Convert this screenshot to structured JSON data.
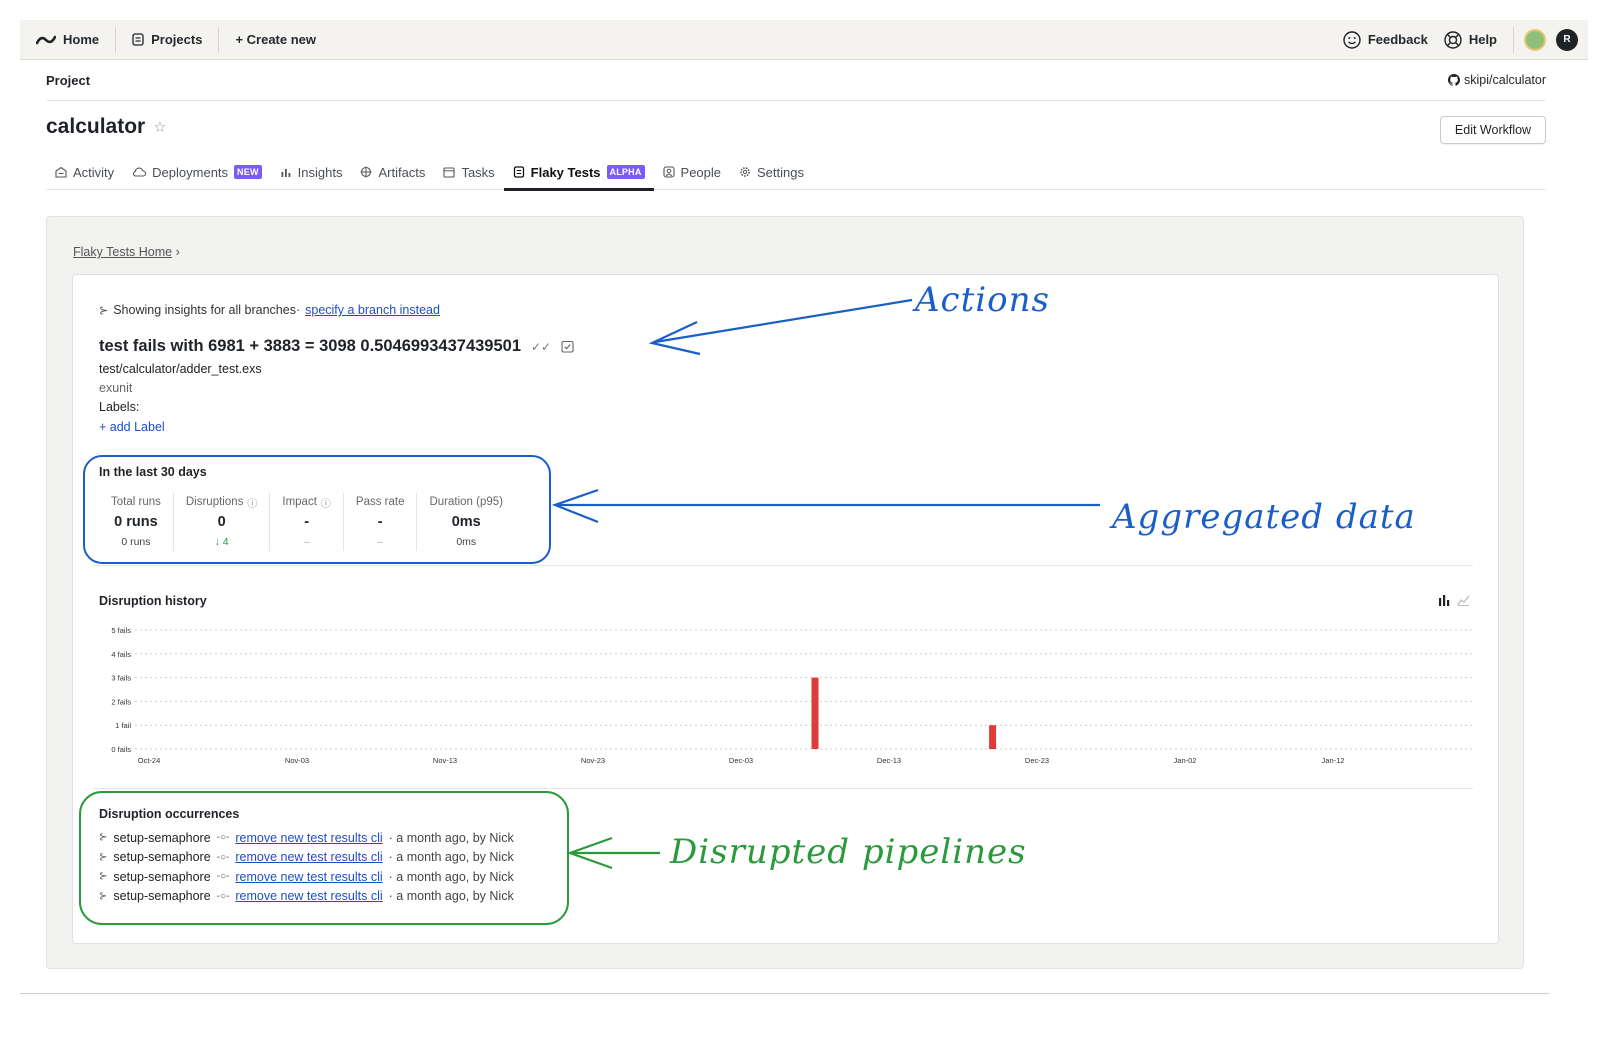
{
  "topbar": {
    "home": "Home",
    "projects": "Projects",
    "create_new": "+ Create new",
    "feedback": "Feedback",
    "help": "Help",
    "avatar_initial": "R"
  },
  "project": {
    "section_label": "Project",
    "repo": "skipi/calculator",
    "name": "calculator",
    "edit_workflow": "Edit Workflow"
  },
  "tabs": [
    {
      "label": "Activity",
      "icon": "activity-icon"
    },
    {
      "label": "Deployments",
      "icon": "cloud-icon",
      "badge": "NEW"
    },
    {
      "label": "Insights",
      "icon": "bar-chart-icon"
    },
    {
      "label": "Artifacts",
      "icon": "artifacts-icon"
    },
    {
      "label": "Tasks",
      "icon": "calendar-icon"
    },
    {
      "label": "Flaky Tests",
      "icon": "flaky-icon",
      "badge": "ALPHA",
      "active": true
    },
    {
      "label": "People",
      "icon": "people-icon"
    },
    {
      "label": "Settings",
      "icon": "gear-icon"
    }
  ],
  "breadcrumb": {
    "link": "Flaky Tests Home",
    "sep": "›"
  },
  "branch_info": {
    "prefix": "Showing insights for all branches·",
    "link": "specify a branch instead"
  },
  "test": {
    "title": "test fails with 6981 + 3883 = 3098 0.5046993437439501",
    "file": "test/calculator/adder_test.exs",
    "runner": "exunit",
    "labels_label": "Labels:",
    "add_label": "+ add Label"
  },
  "aggregated": {
    "title": "In the last 30 days",
    "stats": [
      {
        "label": "Total runs",
        "value": "0 runs",
        "sub": "0 runs"
      },
      {
        "label": "Disruptions",
        "value": "0",
        "sub": "↓ 4"
      },
      {
        "label": "Impact",
        "value": "-",
        "sub": "–"
      },
      {
        "label": "Pass rate",
        "value": "-",
        "sub": "–"
      },
      {
        "label": "Duration (p95)",
        "value": "0ms",
        "sub": "0ms"
      }
    ]
  },
  "chart_data": {
    "type": "bar",
    "title": "Disruption history",
    "y_ticks": [
      "0 fails",
      "1 fail",
      "2 fails",
      "3 fails",
      "4 fails",
      "5 fails"
    ],
    "ylim": [
      0,
      5
    ],
    "x_ticks": [
      "Oct-24",
      "Nov-03",
      "Nov-13",
      "Nov-23",
      "Dec-03",
      "Dec-13",
      "Dec-23",
      "Jan-02",
      "Jan-12"
    ],
    "bars": [
      {
        "date": "Dec-08",
        "value": 3
      },
      {
        "date": "Dec-20",
        "value": 1
      }
    ],
    "bar_color": "#e03a3a",
    "grid": true
  },
  "occurrences": {
    "title": "Disruption occurrences",
    "items": [
      {
        "branch": "setup-semaphore",
        "commit": "remove new test results cli",
        "meta": "· a month ago, by Nick"
      },
      {
        "branch": "setup-semaphore",
        "commit": "remove new test results cli",
        "meta": "· a month ago, by Nick"
      },
      {
        "branch": "setup-semaphore",
        "commit": "remove new test results cli",
        "meta": "· a month ago, by Nick"
      },
      {
        "branch": "setup-semaphore",
        "commit": "remove new test results cli",
        "meta": "· a month ago, by Nick"
      }
    ]
  },
  "annotations": {
    "actions": "Actions",
    "aggregated": "Aggregated data",
    "disrupted": "Disrupted pipelines",
    "blue": "#1a5fc8",
    "green": "#2a9a3a"
  }
}
